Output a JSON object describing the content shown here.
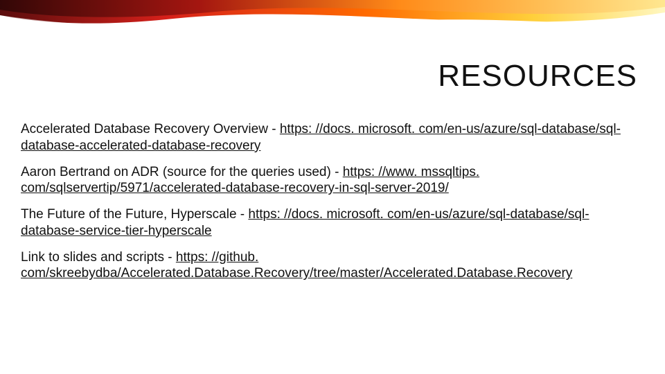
{
  "title": "RESOURCES",
  "items": [
    {
      "pre": "Accelerated Database Recovery Overview - ",
      "link": "https: //docs. microsoft. com/en-us/azure/sql-database/sql-database-accelerated-database-recovery"
    },
    {
      "pre": "Aaron Bertrand on ADR (source for the queries used) - ",
      "link": "https: //www. mssqltips. com/sqlservertip/5971/accelerated-database-recovery-in-sql-server-2019/"
    },
    {
      "pre": "The Future of the Future, Hyperscale - ",
      "link": "https: //docs. microsoft. com/en-us/azure/sql-database/sql-database-service-tier-hyperscale"
    },
    {
      "pre": "Link to slides and scripts - ",
      "link": "https: //github. com/skreebydba/Accelerated.Database.Recovery/tree/master/Accelerated.Database.Recovery"
    }
  ]
}
